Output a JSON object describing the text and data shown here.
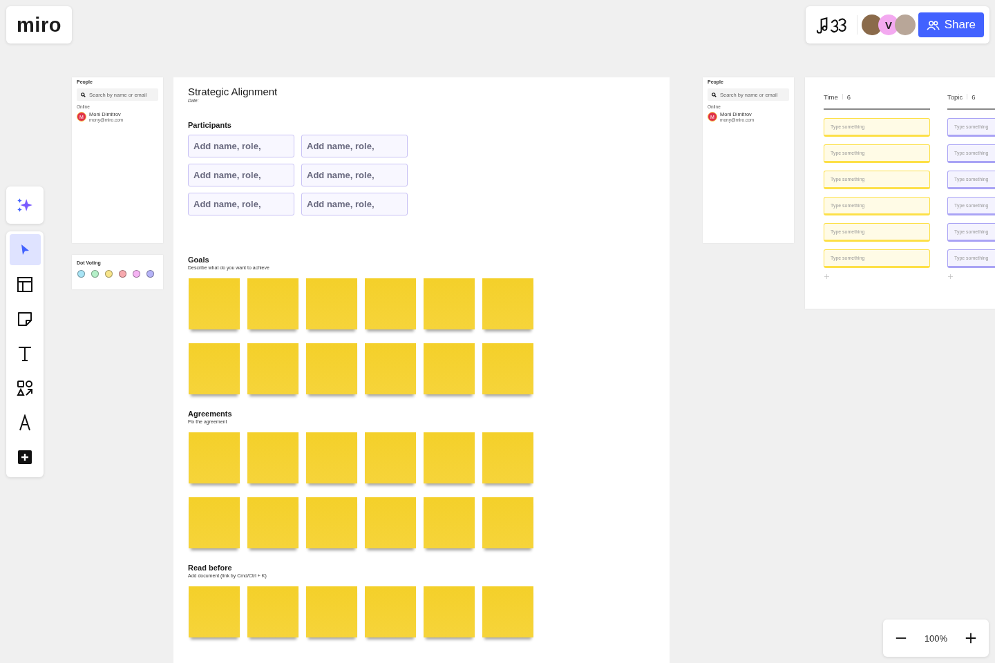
{
  "logo": "miro",
  "top_bar": {
    "avatars": [
      {
        "kind": "photo"
      },
      {
        "kind": "initial",
        "initial": "V"
      },
      {
        "kind": "photo"
      }
    ],
    "share_button": "Share"
  },
  "toolbar": {
    "items": [
      {
        "kind": "select",
        "selected": true
      },
      {
        "kind": "templates",
        "selected": false
      },
      {
        "kind": "sticky",
        "selected": false
      },
      {
        "kind": "text",
        "selected": false
      },
      {
        "kind": "shapes",
        "selected": false
      },
      {
        "kind": "pen",
        "selected": false
      },
      {
        "kind": "more",
        "selected": false
      }
    ]
  },
  "people_panels": [
    {
      "title": "People",
      "search_placeholder": "Search by name or email",
      "section": "Online",
      "user": {
        "initial": "M",
        "name": "Moni Dimitrov",
        "email": "mony@miro.com"
      }
    },
    {
      "title": "People",
      "search_placeholder": "Search by name or email",
      "section": "Online",
      "user": {
        "initial": "M",
        "name": "Moni Dimitrov",
        "email": "mony@miro.com"
      }
    }
  ],
  "dot_voting": {
    "title": "Dot Voting",
    "dots": [
      {
        "color": "#a8e4f5"
      },
      {
        "color": "#b4f0c8"
      },
      {
        "color": "#f8e58a"
      },
      {
        "color": "#f7a9ae"
      },
      {
        "color": "#f5b3f3"
      },
      {
        "color": "#b5b3f7"
      }
    ]
  },
  "board": {
    "title": "Strategic Alignment",
    "date_label": "Date:",
    "participants": {
      "heading": "Participants",
      "fields": [
        "Add name, role,",
        "Add name, role,",
        "Add name, role,",
        "Add name, role,",
        "Add name, role,",
        "Add name, role,"
      ]
    },
    "sections": [
      {
        "heading": "Goals",
        "subtitle": "Describe what do you want to achieve"
      },
      {
        "heading": "Agreements",
        "subtitle": "Fix the agreement"
      },
      {
        "heading": "Read before",
        "subtitle": "Add document (link by Cmd/Ctrl + K)"
      }
    ]
  },
  "kanban": {
    "columns": [
      {
        "title": "Time",
        "count": "6",
        "color": "#fde047",
        "cards": [
          "Type something",
          "Type something",
          "Type something",
          "Type something",
          "Type something",
          "Type something"
        ]
      },
      {
        "title": "Topic",
        "count": "6",
        "color": "#a9a3f5",
        "cards": [
          "Type something",
          "Type something",
          "Type something",
          "Type something",
          "Type something",
          "Type something"
        ]
      }
    ]
  },
  "zoom": {
    "value": "100%"
  }
}
